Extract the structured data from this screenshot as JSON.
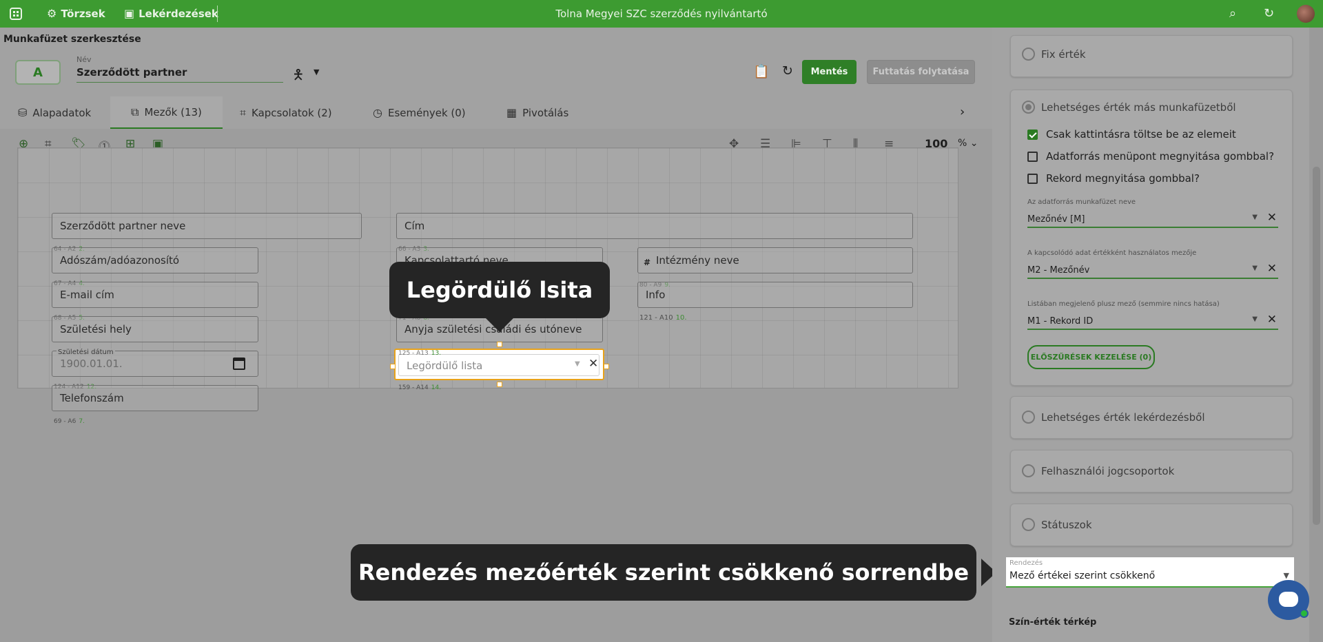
{
  "topbar": {
    "nav_tables": "Törzsek",
    "nav_queries": "Lekérdezések",
    "app_title": "Tolna Megyei SZC szerződés nyilvántartó",
    "brand_color": "#3d9b31"
  },
  "header": {
    "page_title": "Munkafüzet szerkesztése",
    "badge_letter": "A",
    "name_label": "Név",
    "name_value": "Szerződött partner",
    "save_label": "Mentés",
    "run_label": "Futtatás folytatása"
  },
  "tabs": [
    {
      "label": "Alapadatok",
      "icon": "database-icon"
    },
    {
      "label": "Mezők (13)",
      "icon": "fields-icon"
    },
    {
      "label": "Kapcsolatok (2)",
      "icon": "relations-icon"
    },
    {
      "label": "Események (0)",
      "icon": "timer-icon"
    },
    {
      "label": "Pivotálás",
      "icon": "pivot-icon"
    }
  ],
  "toolbar": {
    "zoom_value": "100",
    "zoom_unit": "%"
  },
  "canvas": {
    "fields": [
      {
        "label": "Szerződött partner neve"
      },
      {
        "label": "Cím"
      },
      {
        "label": "Adószám/adóazonosító",
        "tag": "64 - A2",
        "num": "2."
      },
      {
        "label": "Kapcsolattartó neve",
        "tag": "66 - A3",
        "num": "3."
      },
      {
        "label": "Intézmény neve",
        "hash": "#"
      },
      {
        "label": "E-mail cím",
        "tag": "67 - A4",
        "num": "4."
      },
      {
        "label": "Info",
        "tag": "80 - A9",
        "num": "9."
      },
      {
        "label": "Születési hely",
        "tag": "68 - A5",
        "num": "5."
      },
      {
        "label": "Anyja születési családi és utóneve",
        "tag": "71 - A8",
        "num": "8."
      },
      {
        "label": "1900.01.01.",
        "floating_label": "Születési dátum",
        "tag": "12",
        "num": ""
      },
      {
        "label": "Telefonszám",
        "tag": "124 - A12",
        "num": "12."
      }
    ],
    "extra_tags": [
      {
        "tag": "121 - A10",
        "num": "10."
      },
      {
        "tag": "69 - A6",
        "num": "7."
      },
      {
        "tag": "159 - A14",
        "num": "14."
      }
    ],
    "selected": {
      "tag": "125 - A13",
      "num": "13.",
      "placeholder": "Legördülő lista"
    }
  },
  "callouts": {
    "dropdown_hint": "Legördülő lsita",
    "sort_hint": "Rendezés mezőérték szerint csökkenő sorrendbe"
  },
  "panel": {
    "fixed_value": "Fix érték",
    "other_workbook": "Lehetséges érték más munkafüzetből",
    "cb_load_on_click": "Csak kattintásra töltse be az elemeit",
    "cb_open_source": "Adatforrás menüpont megnyitása gombbal?",
    "cb_open_record": "Rekord megnyitása gombbal?",
    "source_label": "Az adatforrás munkafüzet neve",
    "source_value": "Mezőnév [M]",
    "linked_label": "A kapcsolódó adat értékként használatos mezője",
    "linked_value": "M2 - Mezőnév",
    "extra_label": "Listában megjelenő plusz mező (semmire nincs hatása)",
    "extra_value": "M1 - Rekord ID",
    "prefilter_button": "ELŐSZŰRÉSEK KEZELÉSE (0)",
    "from_query": "Lehetséges érték lekérdezésből",
    "user_groups": "Felhasználói jogcsoportok",
    "statuses": "Státuszok",
    "sort_label": "Rendezés",
    "sort_value": "Mező értékei szerint csökkenő",
    "color_map_title": "Szín-érték térkép"
  }
}
